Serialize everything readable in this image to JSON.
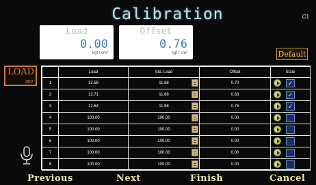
{
  "header": {
    "title": "Calibration",
    "screen_code": "C1"
  },
  "load_readout": {
    "title": "Load",
    "value": "0.00",
    "unit": "kgf / cm²"
  },
  "offset_readout": {
    "title": "Offset",
    "value": "0.76",
    "unit": "kgf / cm²"
  },
  "default_button": "Default",
  "side_load": {
    "label": "LOAD",
    "sub": "2810"
  },
  "table": {
    "headers": [
      "",
      "Load",
      "Std. Load",
      "Offset",
      "State"
    ],
    "rows": [
      {
        "idx": "1",
        "load": "12.58",
        "std": "11.88",
        "offset": "0.70",
        "checked": true
      },
      {
        "idx": "2",
        "load": "12.71",
        "std": "11.88",
        "offset": "0.83",
        "checked": true
      },
      {
        "idx": "3",
        "load": "12.64",
        "std": "11.88",
        "offset": "0.76",
        "checked": true
      },
      {
        "idx": "4",
        "load": "100.00",
        "std": "100.00",
        "offset": "0.00",
        "checked": false
      },
      {
        "idx": "5",
        "load": "100.00",
        "std": "100.00",
        "offset": "0.00",
        "checked": false
      },
      {
        "idx": "6",
        "load": "100.00",
        "std": "100.00",
        "offset": "0.00",
        "checked": false
      },
      {
        "idx": "7",
        "load": "100.00",
        "std": "100.00",
        "offset": "0.00",
        "checked": false
      },
      {
        "idx": "8",
        "load": "100.00",
        "std": "100.00",
        "offset": "0.00",
        "checked": false
      }
    ]
  },
  "footer": {
    "previous": "Previous",
    "next": "Next",
    "finish": "Finish",
    "cancel": "Cancel"
  },
  "icons": {
    "mic": "microphone-icon",
    "play": "play-icon",
    "check": "checkbox-icon"
  },
  "colors": {
    "accent_orange": "#d08a32",
    "title_cyan": "#bde4ee",
    "value_blue": "#3d7fc1",
    "button_text": "#e9e3a6"
  }
}
